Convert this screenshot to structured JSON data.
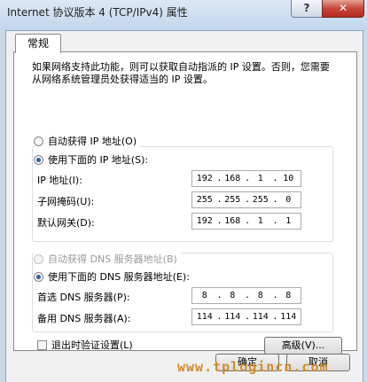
{
  "window": {
    "title": "Internet 协议版本 4 (TCP/IPv4) 属性",
    "help_glyph": "?",
    "close_glyph": "✕"
  },
  "tab": {
    "label": "常规"
  },
  "description": "如果网络支持此功能，则可以获取自动指派的 IP 设置。否则，您需要从网络系统管理员处获得适当的 IP 设置。",
  "ip_settings": {
    "auto_label": "自动获得 IP 地址(O)",
    "manual_label": "使用下面的 IP 地址(S):",
    "selected": "manual",
    "fields": [
      {
        "label": "IP 地址(I):",
        "octets": [
          "192",
          "168",
          "1",
          "10"
        ]
      },
      {
        "label": "子网掩码(U):",
        "octets": [
          "255",
          "255",
          "255",
          "0"
        ]
      },
      {
        "label": "默认网关(D):",
        "octets": [
          "192",
          "168",
          "1",
          "1"
        ]
      }
    ]
  },
  "dns_settings": {
    "auto_label": "自动获得 DNS 服务器地址(B)",
    "manual_label": "使用下面的 DNS 服务器地址(E):",
    "selected": "manual",
    "fields": [
      {
        "label": "首选 DNS 服务器(P):",
        "octets": [
          "8",
          "8",
          "8",
          "8"
        ]
      },
      {
        "label": "备用 DNS 服务器(A):",
        "octets": [
          "114",
          "114",
          "114",
          "114"
        ]
      }
    ]
  },
  "validate_on_exit": {
    "label": "退出时验证设置(L)",
    "checked": false
  },
  "advanced_button": "高级(V)...",
  "ok_button": "确定",
  "cancel_button": "取消",
  "watermark": "www.tplogincn.com"
}
